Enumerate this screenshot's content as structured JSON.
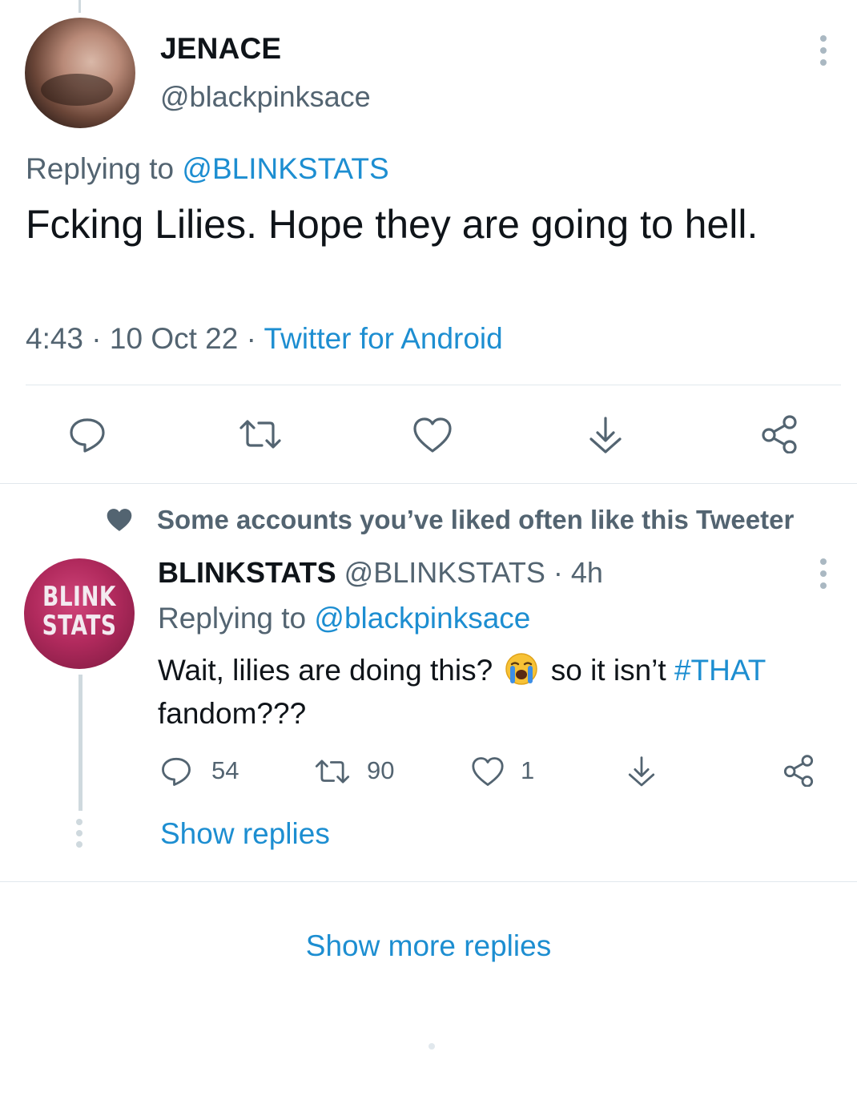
{
  "tweet": {
    "display_name": "JENACE",
    "handle": "@blackpinksace",
    "replying_prefix": "Replying to ",
    "replying_to": "@BLINKSTATS",
    "text": "Fcking Lilies. Hope they are going to hell.",
    "time": "4:43 · 10 Oct 22 · ",
    "source": "Twitter for Android",
    "actions": [
      "reply-icon",
      "retweet-icon",
      "like-icon",
      "download-icon",
      "share-icon"
    ]
  },
  "social_context": "Some accounts you’ve liked often like this Tweeter",
  "reply": {
    "display_name": "BLINKSTATS",
    "handle_time": " @BLINKSTATS · 4h",
    "avatar_logo_line1": "BLINK",
    "avatar_logo_line2": "STATS",
    "replying_prefix": "Replying to ",
    "replying_to": "@blackpinksace",
    "text_part1": "Wait, lilies are doing this?",
    "text_part2": "so it isn’t",
    "hashtag": "#THAT",
    "text_part3": "fandom???",
    "emoji": "loudly-crying-face",
    "stats": {
      "replies": "54",
      "retweets": "90",
      "likes": "1"
    },
    "show_replies": "Show replies"
  },
  "show_more_replies": "Show more replies",
  "colors": {
    "link": "#1d8ed1",
    "secondary_text": "#536471",
    "primary_text": "#0f1419",
    "icon": "#536471",
    "divider": "#e1e8ed"
  }
}
